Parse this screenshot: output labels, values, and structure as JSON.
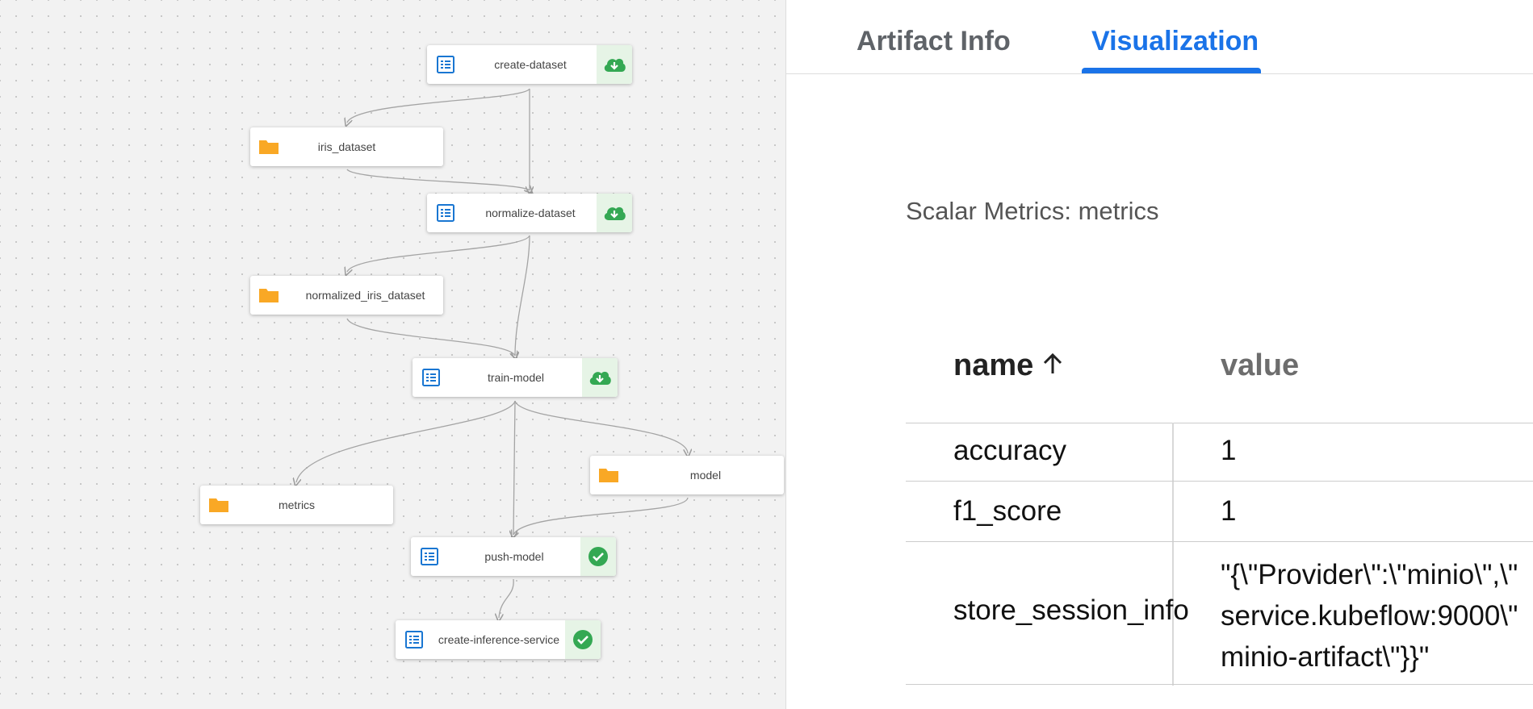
{
  "graph": {
    "nodes": [
      {
        "key": "create_dataset",
        "type": "execution",
        "label": "create-dataset",
        "status": "cloud-download"
      },
      {
        "key": "iris_dataset",
        "type": "artifact",
        "label": "iris_dataset"
      },
      {
        "key": "normalize_dataset",
        "type": "execution",
        "label": "normalize-dataset",
        "status": "cloud-download"
      },
      {
        "key": "normalized_iris_dataset",
        "type": "artifact",
        "label": "normalized_iris_dataset"
      },
      {
        "key": "train_model",
        "type": "execution",
        "label": "train-model",
        "status": "cloud-download"
      },
      {
        "key": "metrics",
        "type": "artifact",
        "label": "metrics"
      },
      {
        "key": "model",
        "type": "artifact",
        "label": "model"
      },
      {
        "key": "push_model",
        "type": "execution",
        "label": "push-model",
        "status": "check-circle"
      },
      {
        "key": "create_inference_service",
        "type": "execution",
        "label": "create-inference-service",
        "status": "check-circle"
      }
    ],
    "icons": {
      "execution": "list-icon",
      "artifact": "folder-icon",
      "cloud-download": "cloud-download-icon",
      "check-circle": "check-circle-icon"
    },
    "colors": {
      "execution_icon": "#1976d2",
      "artifact_icon": "#f9a825",
      "status_icon": "#34a853",
      "status_bg": "#e6f4e6",
      "edge": "#9e9e9e"
    }
  },
  "tabs": [
    {
      "label": "Artifact Info",
      "active": false
    },
    {
      "label": "Visualization",
      "active": true
    }
  ],
  "metrics": {
    "title": "Scalar Metrics: metrics",
    "headers": {
      "name": "name",
      "value": "value",
      "sort_icon": "arrow-up-icon"
    },
    "rows": [
      {
        "name": "accuracy",
        "value": "1"
      },
      {
        "name": "f1_score",
        "value": "1"
      },
      {
        "name": "store_session_info",
        "value_lines": [
          "\"{\\\"Provider\\\":\\\"minio\\\",\\\"",
          "service.kubeflow:9000\\\"",
          "minio-artifact\\\"}}\""
        ]
      }
    ]
  },
  "accent_color": "#1a73e8"
}
